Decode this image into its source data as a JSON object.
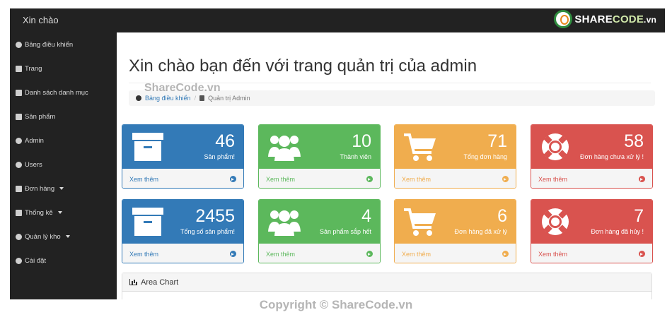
{
  "topbar": {
    "brand": "Xin chào",
    "logo": {
      "part1": "SHARE",
      "part2": "CODE",
      "suffix": ".vn"
    }
  },
  "sidebar": {
    "items": [
      {
        "label": "Bảng điều khiển",
        "icon": "dashboard-icon",
        "caret": false
      },
      {
        "label": "Trang",
        "icon": "file-icon",
        "caret": false
      },
      {
        "label": "Danh sách danh mục",
        "icon": "list-icon",
        "caret": false
      },
      {
        "label": "Sản phẩm",
        "icon": "list-icon",
        "caret": false
      },
      {
        "label": "Admin",
        "icon": "user-icon",
        "caret": false
      },
      {
        "label": "Users",
        "icon": "users-icon",
        "caret": false
      },
      {
        "label": "Đơn hàng",
        "icon": "clone-icon",
        "caret": true
      },
      {
        "label": "Thống kê",
        "icon": "clone-icon",
        "caret": true
      },
      {
        "label": "Quản lý kho",
        "icon": "cogs-icon",
        "caret": true
      },
      {
        "label": "Cài đặt",
        "icon": "cogs-icon",
        "caret": false
      }
    ]
  },
  "main": {
    "title": "Xin chào bạn đến với trang quản trị của admin",
    "breadcrumb": {
      "home": "Bảng điều khiển",
      "current": "Quản trị Admin"
    },
    "panels": [
      {
        "value": "46",
        "label": "Sản phẩm!",
        "footer": "Xem thêm",
        "color": "#337ab7",
        "icon": "archive-icon"
      },
      {
        "value": "10",
        "label": "Thành viên",
        "footer": "Xem thêm",
        "color": "#5cb85c",
        "icon": "users-icon"
      },
      {
        "value": "71",
        "label": "Tổng đơn hàng",
        "footer": "Xem thêm",
        "color": "#f0ad4e",
        "icon": "cart-icon"
      },
      {
        "value": "58",
        "label": "Đơn hàng chưa xử lý !",
        "footer": "Xem thêm",
        "color": "#d9534f",
        "icon": "lifebuoy-icon"
      },
      {
        "value": "2455",
        "label": "Tổng số sản phẩm!",
        "footer": "Xem thêm",
        "color": "#337ab7",
        "icon": "archive-icon"
      },
      {
        "value": "4",
        "label": "Sản phẩm sắp hết",
        "footer": "Xem thêm",
        "color": "#5cb85c",
        "icon": "users-icon"
      },
      {
        "value": "6",
        "label": "Đơn hàng đã xử lý",
        "footer": "Xem thêm",
        "color": "#f0ad4e",
        "icon": "cart-icon"
      },
      {
        "value": "7",
        "label": "Đơn hàng đã hủy !",
        "footer": "Xem thêm",
        "color": "#d9534f",
        "icon": "lifebuoy-icon"
      }
    ],
    "chart_panel": {
      "title": "Area Chart"
    }
  },
  "watermark": {
    "breadcrumb_overlay": "ShareCode.vn",
    "copyright": "Copyright © ShareCode.vn"
  }
}
